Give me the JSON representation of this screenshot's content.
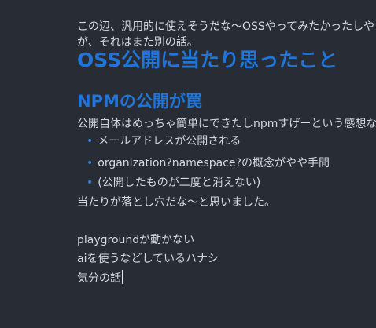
{
  "document": {
    "intro_line_1": "この辺、汎用的に使えそうだな〜OSSやってみたかったしやるか",
    "intro_line_2": "が、それはまた別の話。",
    "heading_1": "OSS公開に当たり思ったこと",
    "heading_2": "NPMの公開が罠",
    "paragraph_1": "公開自体はめっちゃ簡単にできたしnpmすげーという感想なので",
    "bullets": [
      "メールアドレスが公開される",
      "organization?namespace?の概念がやや手間",
      "(公開したものが二度と消えない)"
    ],
    "bullet_marker": "•",
    "paragraph_2": "当たりが落とし穴だな〜と思いました。",
    "line_playground": "playgroundが動かない",
    "line_ai": "aiを使うなどしているハナシ",
    "line_kibun": "気分の話"
  },
  "colors": {
    "background": "#282c34",
    "text": "#d4d9e2",
    "heading": "#1f75d9",
    "bullet": "#3b82d6"
  }
}
